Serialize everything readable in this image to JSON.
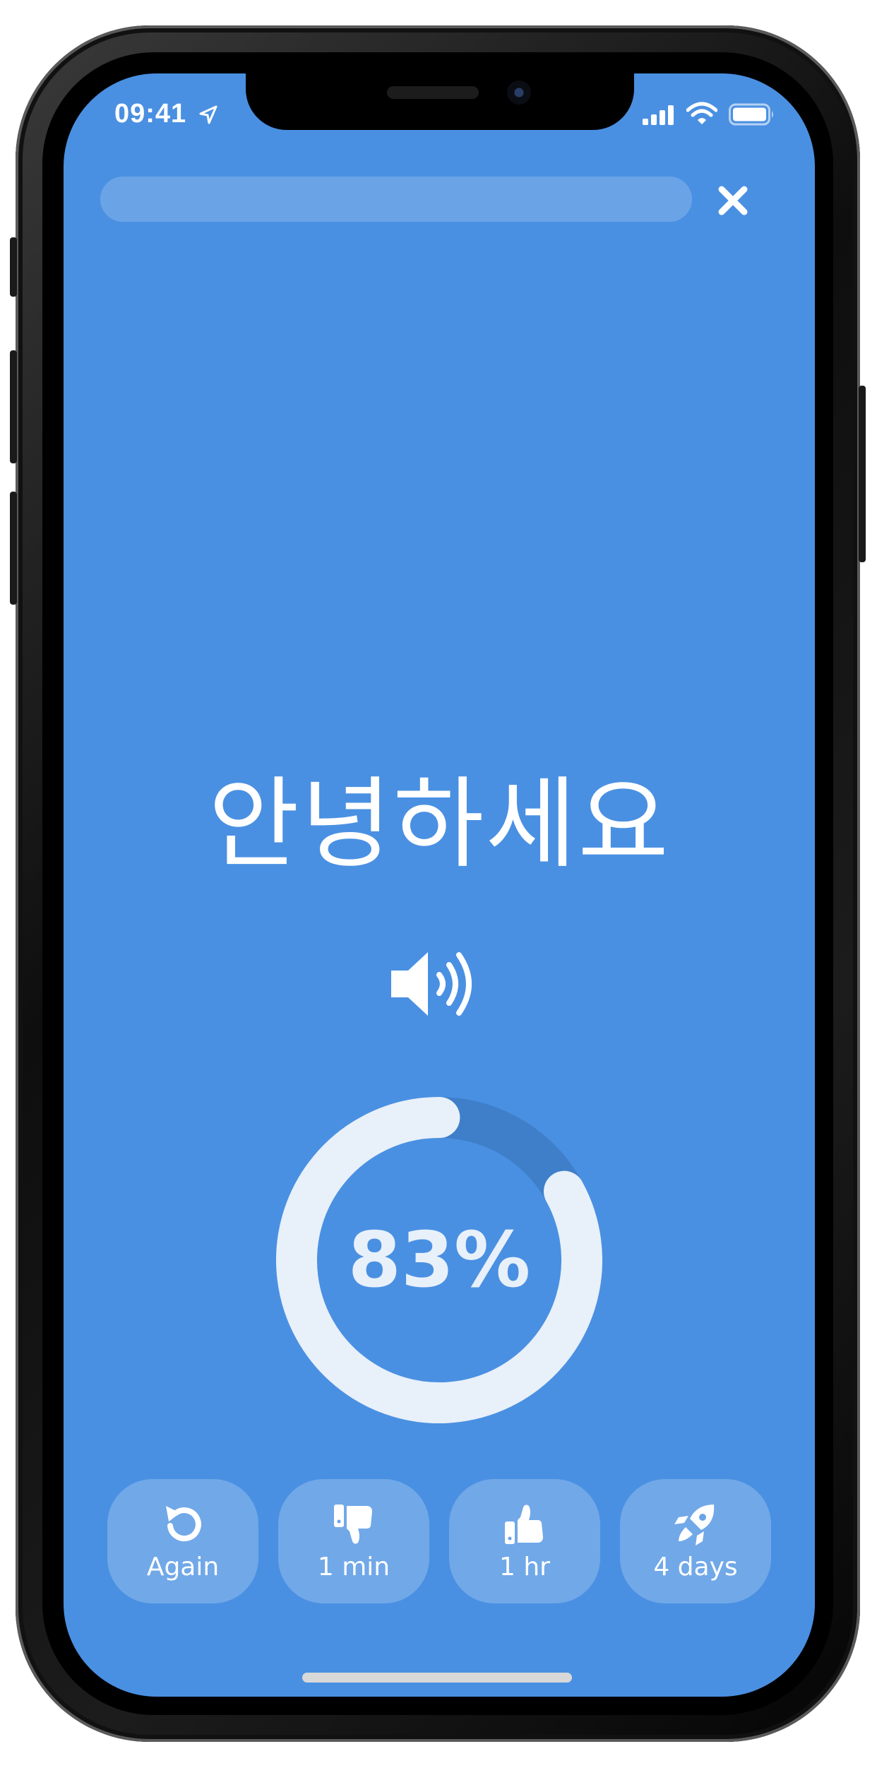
{
  "status_bar": {
    "time": "09:41"
  },
  "session": {
    "progress": 0.0
  },
  "card": {
    "word": "안녕하세요",
    "score_label": "83%",
    "score": 83
  },
  "answers": [
    {
      "label": "Again",
      "icon": "undo-icon"
    },
    {
      "label": "1 min",
      "icon": "thumbs-down-icon"
    },
    {
      "label": "1 hr",
      "icon": "thumbs-up-icon"
    },
    {
      "label": "4 days",
      "icon": "rocket-icon"
    }
  ],
  "colors": {
    "background": "#4a90e2",
    "ring_track": "#3f7fc9",
    "ring_fill": "#e8f0fa",
    "button_bg": "rgba(255,255,255,0.22)"
  }
}
